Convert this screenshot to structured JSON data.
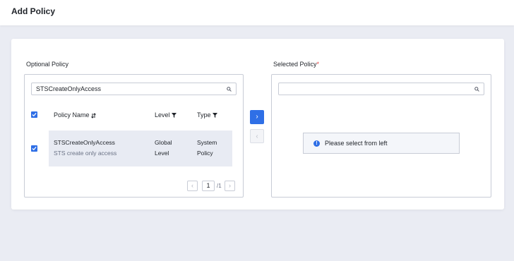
{
  "header": {
    "title": "Add Policy"
  },
  "optional": {
    "label": "Optional Policy",
    "search_value": "STSCreateOnlyAccess",
    "columns": {
      "name": "Policy Name",
      "level": "Level",
      "type": "Type"
    },
    "rows": [
      {
        "checked": true,
        "name": "STSCreateOnlyAccess",
        "description": "STS create only access",
        "level_line1": "Global",
        "level_line2": "Level",
        "type_line1": "System",
        "type_line2": "Policy"
      }
    ],
    "pager": {
      "prev": "‹",
      "current": "1",
      "total": "/1",
      "next": "›"
    }
  },
  "transfer": {
    "to_right": "›",
    "to_left": "‹"
  },
  "selected": {
    "label": "Selected Policy",
    "required_mark": "*",
    "search_value": "",
    "empty_message": "Please select from left"
  },
  "colors": {
    "accent": "#2f6fe6",
    "required": "#e64545",
    "row_highlight": "#e8ebf3"
  }
}
